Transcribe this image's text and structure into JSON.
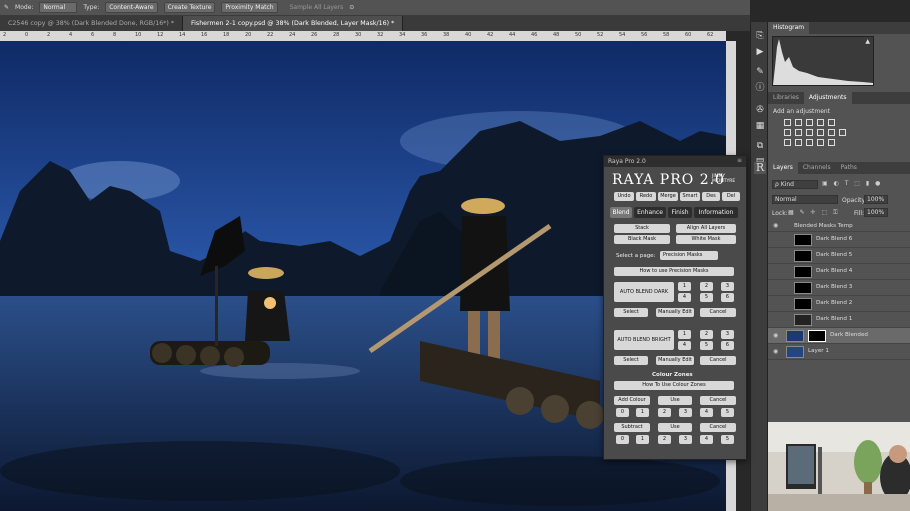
{
  "optbar": {
    "mode_label": "Mode:",
    "mode_value": "Normal",
    "type_label": "Type:",
    "btn_content_aware": "Content-Aware",
    "btn_create_texture": "Create Texture",
    "btn_proximity_match": "Proximity Match",
    "sample_all_layers": "Sample All Layers"
  },
  "tabs": [
    {
      "label": "C2546 copy @ 38% (Dark Blended Done, RGB/16*) *"
    },
    {
      "label": "Fishermen 2-1 copy.psd @ 38% (Dark Blended, Layer Mask/16) *"
    }
  ],
  "ruler_ticks": [
    "2",
    "0",
    "2",
    "4",
    "6",
    "8",
    "10",
    "12",
    "14",
    "16",
    "18",
    "20",
    "22",
    "24",
    "26",
    "28",
    "30",
    "32",
    "34",
    "36",
    "38",
    "40",
    "42",
    "44",
    "46",
    "48",
    "50",
    "52",
    "54",
    "56",
    "58",
    "60",
    "62"
  ],
  "histogram": {
    "tab": "Histogram"
  },
  "adjust": {
    "tab_libraries": "Libraries",
    "tab_adjustments": "Adjustments",
    "add_label": "Add an adjustment"
  },
  "layers": {
    "tab_layers": "Layers",
    "tab_channels": "Channels",
    "tab_paths": "Paths",
    "kind": "ρ Kind",
    "blend": "Normal",
    "opacity_label": "Opacity:",
    "opacity_value": "100%",
    "lock_label": "Lock:",
    "fill_label": "Fill:",
    "fill_value": "100%",
    "group": "Blended Masks Temp",
    "items": [
      {
        "name": "Dark Blend 6"
      },
      {
        "name": "Dark Blend 5"
      },
      {
        "name": "Dark Blend 4"
      },
      {
        "name": "Dark Blend 3"
      },
      {
        "name": "Dark Blend 2"
      },
      {
        "name": "Dark Blend 1"
      },
      {
        "name": "Dark Blended"
      },
      {
        "name": "Layer 1"
      }
    ]
  },
  "raya": {
    "title": "Raya Pro 2.0",
    "logo": "RAYA PRO 2.0",
    "logo_sub": "JIMMY MCINTYRE",
    "top_buttons": [
      "Undo",
      "Redo",
      "Merge",
      "Smart",
      "Des",
      "Del"
    ],
    "tabs": [
      "Blend",
      "Enhance",
      "Finish",
      "Information"
    ],
    "stack": "Stack",
    "align_all": "Align All Layers",
    "black_mask": "Black Mask",
    "white_mask": "White Mask",
    "select_page_label": "Select a page:",
    "select_page_value": "Precision Masks",
    "how_precision": "How to use Precision Masks",
    "auto_dark": "AUTO BLEND DARK",
    "auto_bright": "AUTO BLEND BRIGHT",
    "nums_a": [
      "1",
      "2",
      "3",
      "4",
      "5",
      "6"
    ],
    "select": "Select",
    "manually_edit": "Manually Edit",
    "cancel": "Cancel",
    "colour_zones": "Colour Zones",
    "how_colour": "How To Use Colour Zones",
    "add_colour": "Add Colour",
    "use": "Use",
    "subtract": "Subtract",
    "zone_nums": [
      "0",
      "1",
      "2",
      "3",
      "4",
      "5"
    ]
  }
}
